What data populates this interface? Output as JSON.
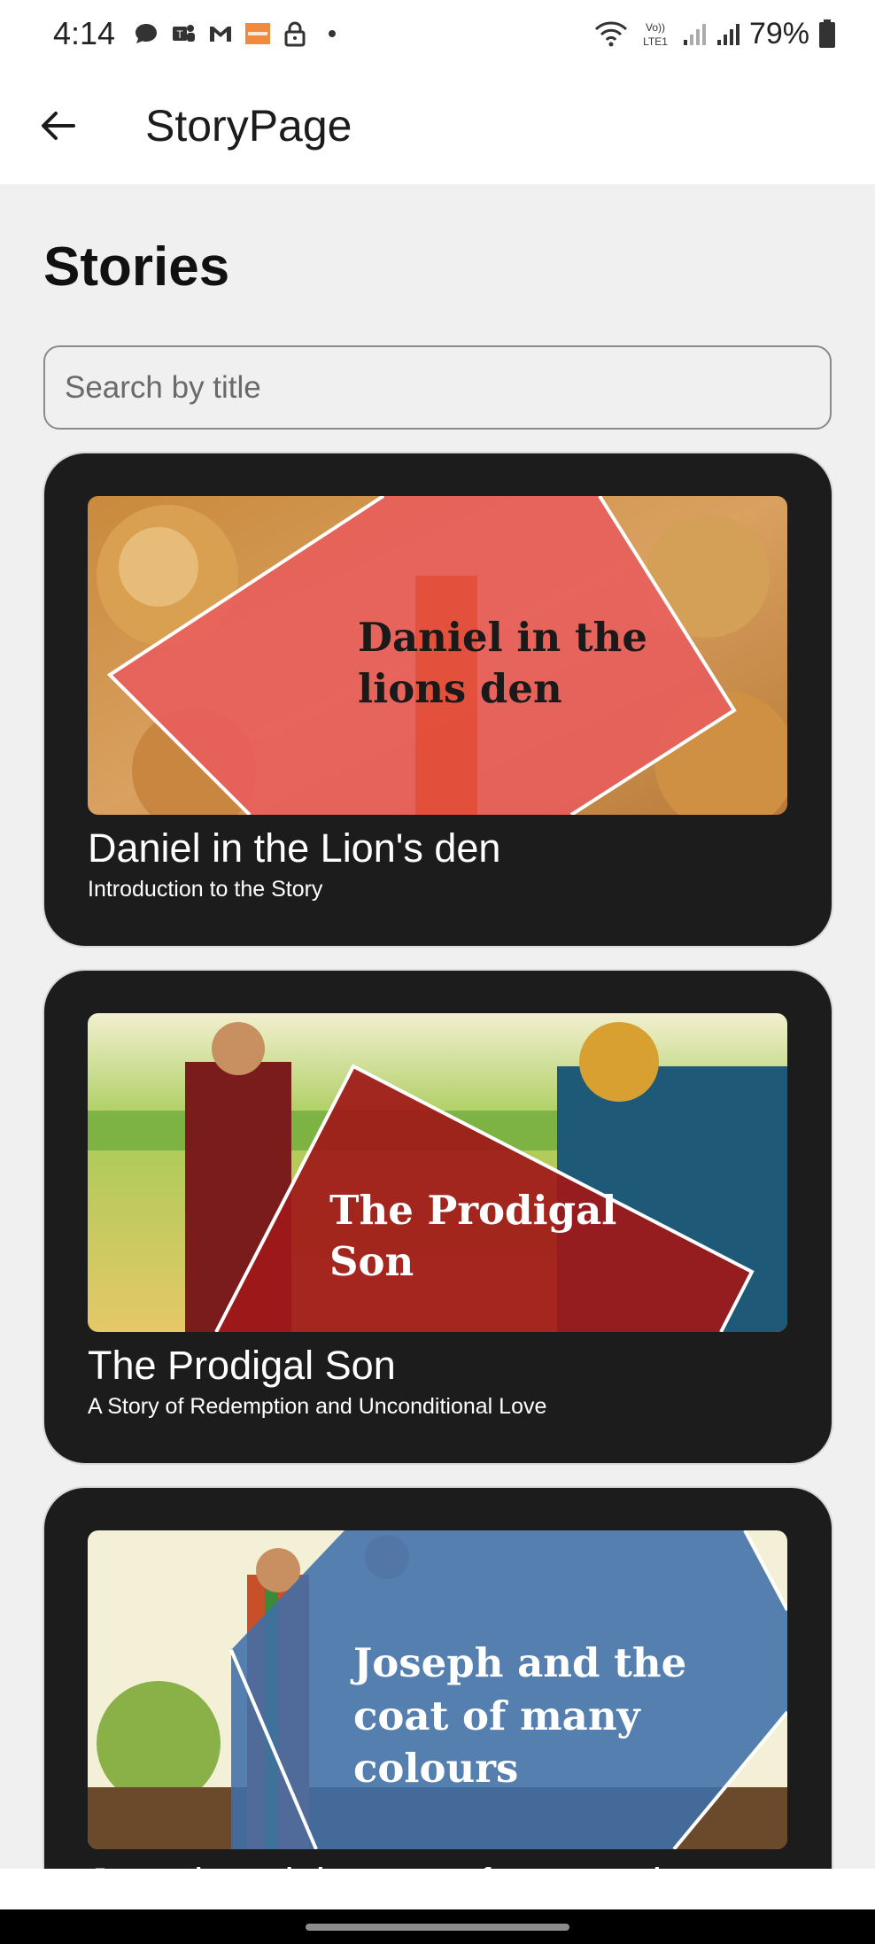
{
  "status_bar": {
    "time": "4:14",
    "battery": "79%",
    "network_label": "Vo) LTE1",
    "notification_icons": [
      "chat-bubble-icon",
      "teams-icon",
      "gmail-icon",
      "hutch-icon",
      "lock-icon",
      "dot-icon"
    ],
    "system_icons": [
      "wifi-icon",
      "lte-icon",
      "signal-weak-icon",
      "signal-icon",
      "battery-icon"
    ]
  },
  "app_bar": {
    "back_icon": "arrow-left-icon",
    "title": "StoryPage"
  },
  "page": {
    "heading": "Stories",
    "search_placeholder": "Search by title"
  },
  "stories": [
    {
      "image_text": [
        "Daniel in the",
        "lions den"
      ],
      "title": "Daniel in the Lion's den",
      "subtitle": "Introduction to the Story"
    },
    {
      "image_text": [
        "The Prodigal",
        "Son"
      ],
      "title": "The Prodigal Son",
      "subtitle": "A Story of Redemption and Unconditional Love"
    },
    {
      "image_text": [
        "Joseph and the",
        "coat of many",
        "colours"
      ],
      "title": "Joseph and the coat of many colours",
      "subtitle": ""
    }
  ],
  "colors": {
    "card_background": "#1c1c1c",
    "page_background": "#f0f0f0",
    "story1_overlay": "#e85c5c",
    "story2_overlay": "#a01818",
    "story3_overlay": "#3f6ea8"
  }
}
